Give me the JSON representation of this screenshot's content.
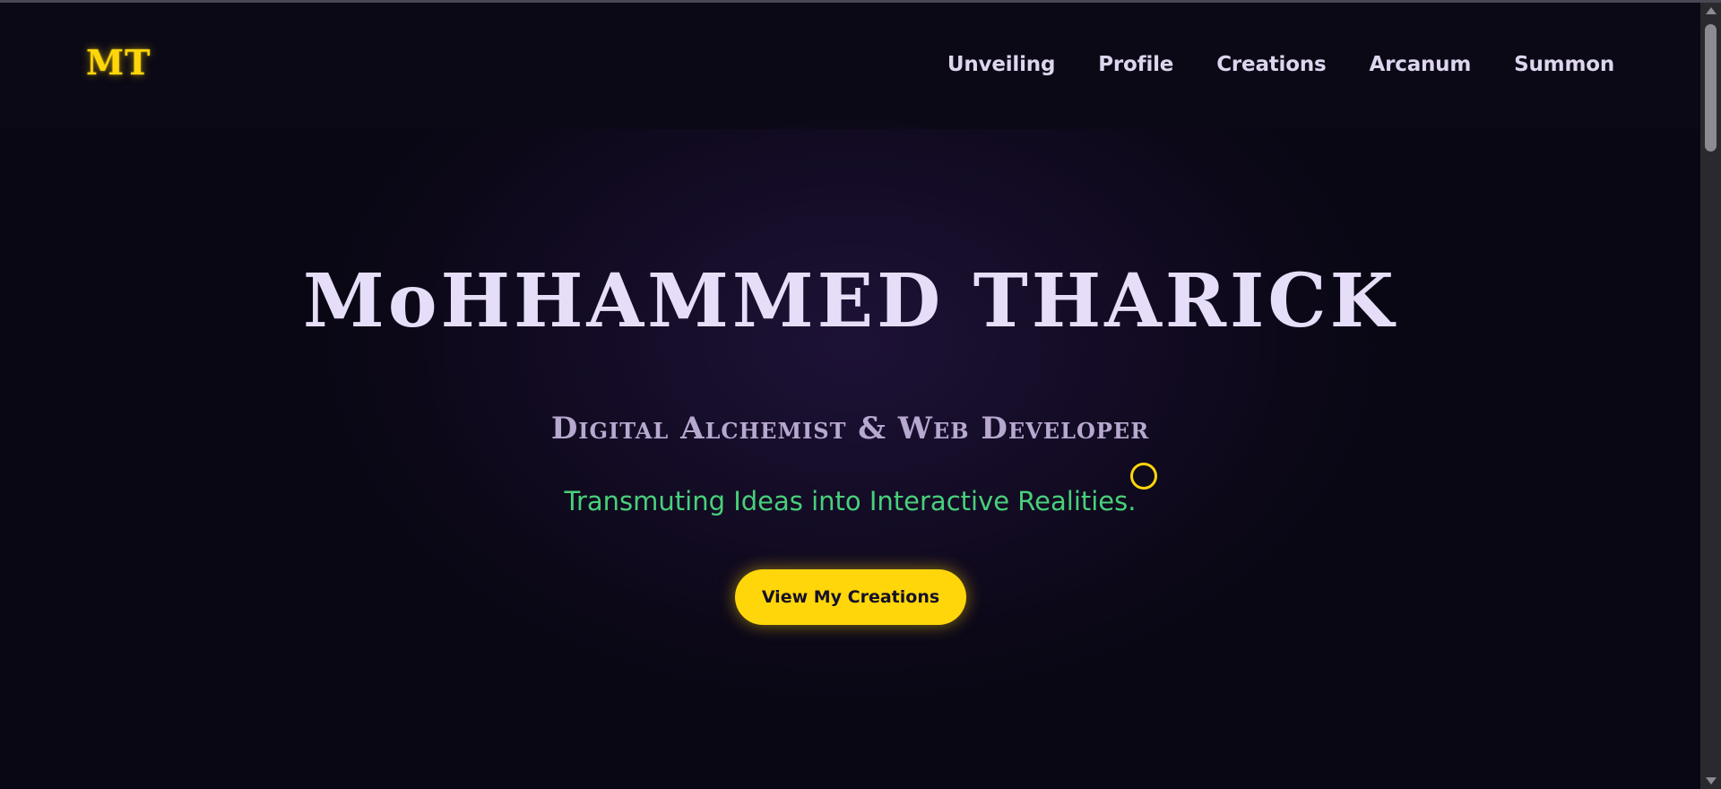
{
  "header": {
    "logo": "MT",
    "nav": [
      {
        "label": "Unveiling"
      },
      {
        "label": "Profile"
      },
      {
        "label": "Creations"
      },
      {
        "label": "Arcanum"
      },
      {
        "label": "Summon"
      }
    ]
  },
  "hero": {
    "title": "MoHHAMMED THARICK",
    "subtitle": "Digital Alchemist & Web Developer",
    "tagline": "Transmuting Ideas into Interactive Realities.",
    "cta_label": "View My Creations"
  },
  "colors": {
    "background": "#0a0714",
    "accent": "#ffd60a",
    "heading": "#e6def8",
    "subheading": "#b7a8cf",
    "tagline": "#48d07a"
  }
}
